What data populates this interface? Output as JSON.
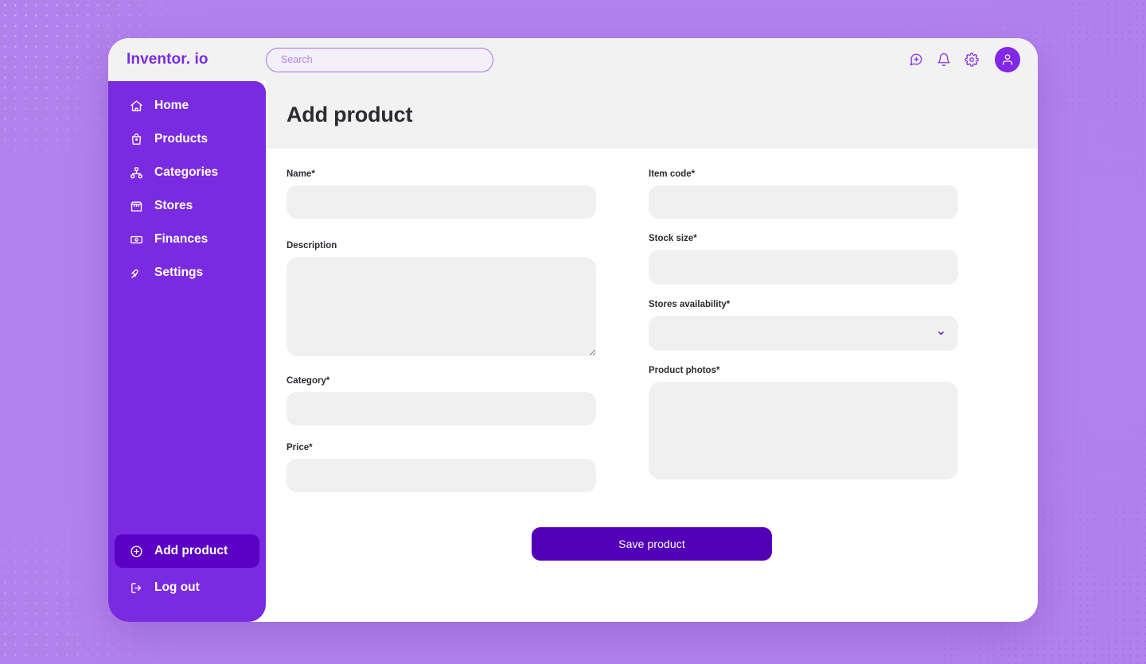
{
  "brand": {
    "name": "Inventor. io"
  },
  "search": {
    "placeholder": "Search",
    "value": ""
  },
  "topbar_icons": [
    {
      "name": "message-plus-icon",
      "label": "New message"
    },
    {
      "name": "bell-icon",
      "label": "Notifications"
    },
    {
      "name": "gear-icon",
      "label": "Settings"
    }
  ],
  "avatar": {
    "name": "user-avatar",
    "label": "Account"
  },
  "sidebar": {
    "items": [
      {
        "label": "Home",
        "icon": "home-icon",
        "active": false
      },
      {
        "label": "Products",
        "icon": "bag-icon",
        "active": false
      },
      {
        "label": "Categories",
        "icon": "hierarchy-icon",
        "active": false
      },
      {
        "label": "Stores",
        "icon": "store-icon",
        "active": false
      },
      {
        "label": "Finances",
        "icon": "banknote-icon",
        "active": false
      },
      {
        "label": "Settings",
        "icon": "wrench-icon",
        "active": false
      }
    ],
    "bottom_items": [
      {
        "label": "Add product",
        "icon": "plus-circle-icon",
        "active": true
      },
      {
        "label": "Log out",
        "icon": "logout-icon",
        "active": false
      }
    ]
  },
  "page": {
    "title": "Add product"
  },
  "form": {
    "left": [
      {
        "label": "Name*",
        "type": "text",
        "value": "",
        "field": "name"
      },
      {
        "label": "Description",
        "type": "textarea",
        "value": "",
        "field": "description"
      },
      {
        "label": "Category*",
        "type": "text",
        "value": "",
        "field": "category"
      },
      {
        "label": "Price*",
        "type": "text",
        "value": "",
        "field": "price"
      }
    ],
    "right": [
      {
        "label": "Item code*",
        "type": "text",
        "value": "",
        "field": "item_code"
      },
      {
        "label": "Stock size*",
        "type": "text",
        "value": "",
        "field": "stock_size"
      },
      {
        "label": "Stores availability*",
        "type": "select",
        "value": "",
        "field": "stores_availability"
      },
      {
        "label": "Product photos*",
        "type": "upload",
        "value": "",
        "field": "product_photos"
      }
    ],
    "submit_label": "Save product"
  },
  "colors": {
    "page_background": "#b282ec",
    "sidebar": "#7a2be2",
    "sidebar_active": "#5b00c4",
    "brand_purple": "#7a2be2",
    "accent_deep": "#5200b8",
    "header_gray": "#f2f2f2",
    "input_gray": "#f0f0f0",
    "text_dark": "#2b2b31"
  }
}
